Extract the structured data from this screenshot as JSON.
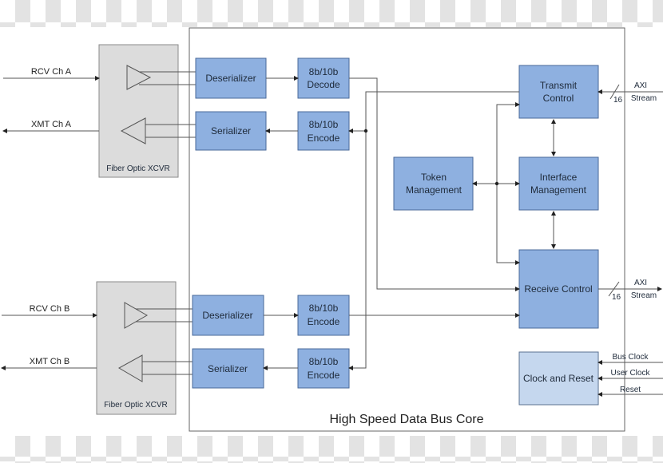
{
  "diagram": {
    "title": "High Speed Data Bus Core",
    "channels": [
      {
        "rcv_label": "RCV Ch A",
        "xmt_label": "XMT Ch A",
        "xcvr_label": "Fiber Optic XCVR",
        "deserializer": "Deserializer",
        "serializer": "Serializer",
        "rx_codec": [
          "8b/10b",
          "Decode"
        ],
        "tx_codec": [
          "8b/10b",
          "Encode"
        ]
      },
      {
        "rcv_label": "RCV Ch B",
        "xmt_label": "XMT Ch B",
        "xcvr_label": "Fiber Optic XCVR",
        "deserializer": "Deserializer",
        "serializer": "Serializer",
        "rx_codec": [
          "8b/10b",
          "Encode"
        ],
        "tx_codec": [
          "8b/10b",
          "Encode"
        ]
      }
    ],
    "blocks": {
      "transmit_control": [
        "Transmit",
        "Control"
      ],
      "interface_management": [
        "Interface",
        "Management"
      ],
      "token_management": [
        "Token",
        "Management"
      ],
      "receive_control": "Receive Control",
      "clock_and_reset": "Clock and Reset"
    },
    "external": {
      "axi_tx": [
        "AXI",
        "Stream"
      ],
      "axi_rx": [
        "AXI",
        "Stream"
      ],
      "bus_width_tx": "16",
      "bus_width_rx": "16",
      "bus_clock": "Bus Clock",
      "user_clock": "User Clock",
      "reset": "Reset"
    }
  }
}
